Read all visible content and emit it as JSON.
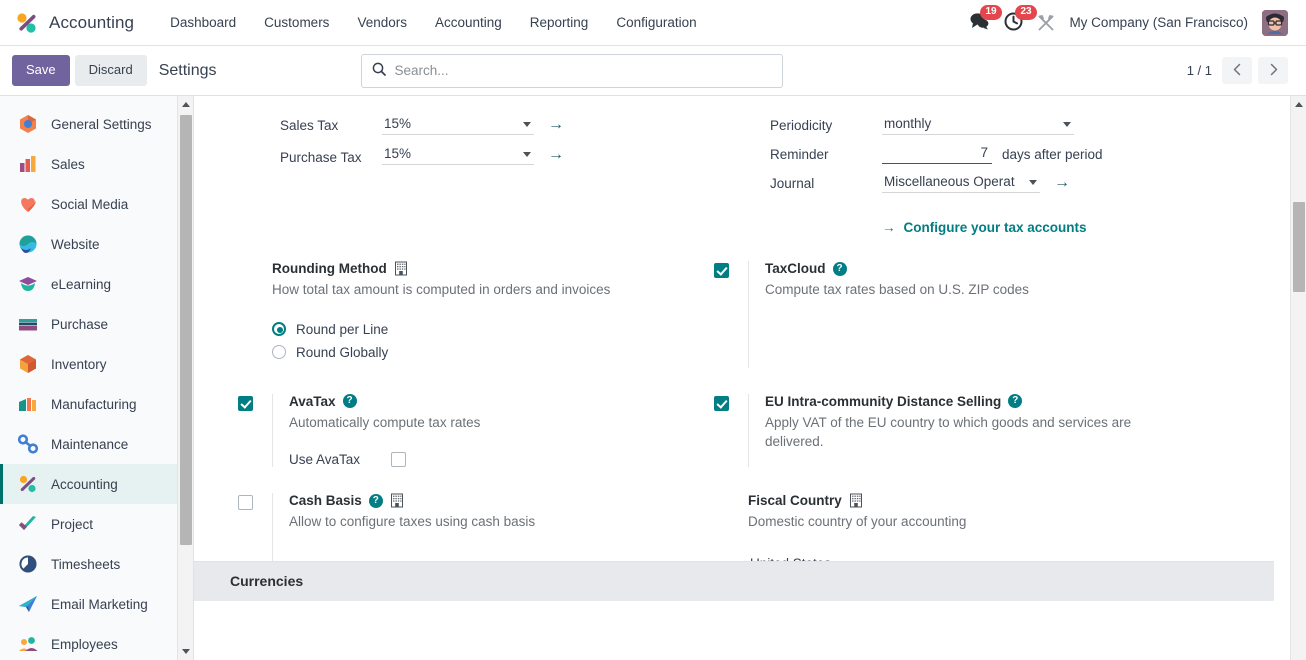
{
  "navbar": {
    "brand": "Accounting",
    "brand_logo_icon": "odoo-accounting-logo-icon",
    "menu": [
      "Dashboard",
      "Customers",
      "Vendors",
      "Accounting",
      "Reporting",
      "Configuration"
    ],
    "messages_icon": "chat-bubble-icon",
    "messages_count": "19",
    "activities_icon": "clock-icon",
    "activities_count": "23",
    "debug_icon": "wrench-tools-icon",
    "company": "My Company (San Francisco)",
    "avatar_icon": "user-avatar-icon"
  },
  "control_panel": {
    "save_label": "Save",
    "discard_label": "Discard",
    "title": "Settings",
    "search_placeholder": "Search...",
    "search_value": "",
    "search_icon": "search-icon",
    "pager_count": "1 / 1",
    "prev_icon": "chevron-left-icon",
    "next_icon": "chevron-right-icon"
  },
  "sidebar": {
    "items": [
      {
        "label": "General Settings",
        "icon": "general-settings-icon",
        "active": false
      },
      {
        "label": "Sales",
        "icon": "sales-icon",
        "active": false
      },
      {
        "label": "Social Media",
        "icon": "social-media-icon",
        "active": false
      },
      {
        "label": "Website",
        "icon": "website-icon",
        "active": false
      },
      {
        "label": "eLearning",
        "icon": "elearning-icon",
        "active": false
      },
      {
        "label": "Purchase",
        "icon": "purchase-icon",
        "active": false
      },
      {
        "label": "Inventory",
        "icon": "inventory-icon",
        "active": false
      },
      {
        "label": "Manufacturing",
        "icon": "manufacturing-icon",
        "active": false
      },
      {
        "label": "Maintenance",
        "icon": "maintenance-icon",
        "active": false
      },
      {
        "label": "Accounting",
        "icon": "accounting-icon",
        "active": true
      },
      {
        "label": "Project",
        "icon": "project-icon",
        "active": false
      },
      {
        "label": "Timesheets",
        "icon": "timesheets-icon",
        "active": false
      },
      {
        "label": "Email Marketing",
        "icon": "email-marketing-icon",
        "active": false
      },
      {
        "label": "Employees",
        "icon": "employees-icon",
        "active": false
      }
    ]
  },
  "taxes": {
    "sales_tax_label": "Sales Tax",
    "sales_tax_value": "15%",
    "purchase_tax_label": "Purchase Tax",
    "purchase_tax_value": "15%",
    "internal_link_icon": "arrow-right-icon"
  },
  "tax_return": {
    "periodicity_label": "Periodicity",
    "periodicity_value": "monthly",
    "reminder_label": "Reminder",
    "reminder_value": "7",
    "reminder_suffix": "days after period",
    "journal_label": "Journal",
    "journal_value": "Miscellaneous Operat",
    "configure_link": "Configure your tax accounts",
    "configure_link_icon": "arrow-right-icon"
  },
  "settings_items": {
    "rounding_method": {
      "title": "Rounding Method",
      "description": "How total tax amount is computed in orders and invoices",
      "company_icon": "building-icon",
      "options": [
        {
          "label": "Round per Line",
          "selected": true
        },
        {
          "label": "Round Globally",
          "selected": false
        }
      ]
    },
    "taxcloud": {
      "title": "TaxCloud",
      "description": "Compute tax rates based on U.S. ZIP codes",
      "checked": true,
      "help_icon": "question-mark-icon"
    },
    "avatax": {
      "title": "AvaTax",
      "description": "Automatically compute tax rates",
      "checked": true,
      "help_icon": "question-mark-icon",
      "sub_label": "Use AvaTax",
      "sub_checked": false
    },
    "eu_distance_selling": {
      "title": "EU Intra-community Distance Selling",
      "description": "Apply VAT of the EU country to which goods and services are delivered.",
      "checked": true,
      "help_icon": "question-mark-icon"
    },
    "cash_basis": {
      "title": "Cash Basis",
      "description": "Allow to configure taxes using cash basis",
      "checked": false,
      "help_icon": "question-mark-icon",
      "company_icon": "building-icon"
    },
    "fiscal_country": {
      "title": "Fiscal Country",
      "description": "Domestic country of your accounting",
      "company_icon": "building-icon",
      "value": "United States"
    }
  },
  "next_section": {
    "title": "Currencies"
  },
  "colors": {
    "accent_teal": "#017e84",
    "save_purple": "#71639e",
    "badge_red": "#e4464e",
    "active_sidebar_bg": "#e6f2f1",
    "section_header_bg": "#e7e9ed"
  }
}
